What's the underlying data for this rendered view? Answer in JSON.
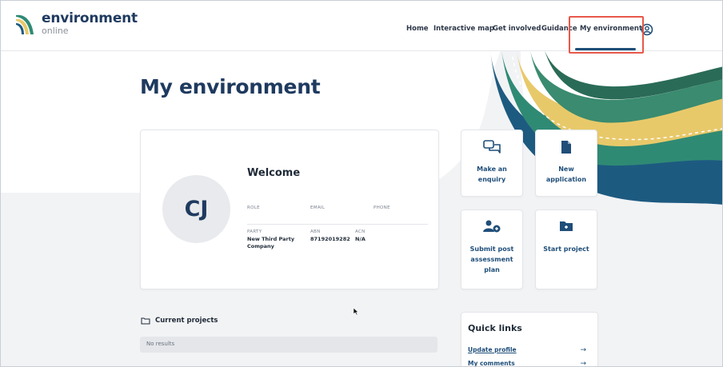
{
  "logo": {
    "name": "environment",
    "sub": "online"
  },
  "nav": {
    "items": [
      {
        "label": "Home"
      },
      {
        "label": "Interactive map"
      },
      {
        "label": "Get involved"
      },
      {
        "label": "Guidance"
      },
      {
        "label": "My environment"
      }
    ],
    "active": "My environment"
  },
  "page": {
    "title": "My environment"
  },
  "profile": {
    "initials": "CJ",
    "welcome": "Welcome",
    "role_label": "ROLE",
    "email_label": "EMAIL",
    "phone_label": "PHONE",
    "party_label": "PARTY",
    "party_value": "New Third Party Company",
    "abn_label": "ABN",
    "abn_value": "87192019282",
    "acn_label": "ACN",
    "acn_value": "N/A"
  },
  "tiles": [
    {
      "label": "Make an enquiry",
      "icon": "chat-icon"
    },
    {
      "label": "New application",
      "icon": "document-icon"
    },
    {
      "label": "Submit post assessment plan",
      "icon": "user-plus-icon"
    },
    {
      "label": "Start project",
      "icon": "folder-plus-icon"
    }
  ],
  "current_projects": {
    "title": "Current projects",
    "empty": "No results"
  },
  "quick_links": {
    "title": "Quick links",
    "links": [
      {
        "label": "Update profile"
      },
      {
        "label": "My comments"
      }
    ]
  },
  "colors": {
    "navy": "#1e3a5f",
    "teal": "#2f8a74",
    "yellow": "#e8c96a",
    "highlight": "#e8584a"
  }
}
